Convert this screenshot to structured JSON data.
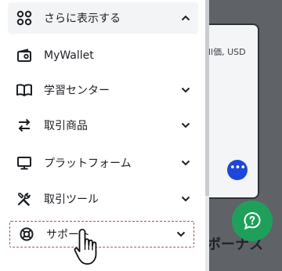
{
  "menu": {
    "items": [
      {
        "label": "さらに表示する",
        "icon": "grid-icon",
        "chevron": "up"
      },
      {
        "label": "MyWallet",
        "icon": "wallet-icon",
        "chevron": "none"
      },
      {
        "label": "学習センター",
        "icon": "book-icon",
        "chevron": "down"
      },
      {
        "label": "取引商品",
        "icon": "swap-arrows-icon",
        "chevron": "down"
      },
      {
        "label": "プラットフォーム",
        "icon": "monitor-icon",
        "chevron": "down"
      },
      {
        "label": "取引ツール",
        "icon": "tools-icon",
        "chevron": "down"
      },
      {
        "label": "サポート",
        "icon": "lifebuoy-icon",
        "chevron": "down"
      }
    ]
  },
  "background": {
    "card_text": "ll価, USD",
    "more_label": "•••",
    "heading": "ボーナス"
  },
  "colors": {
    "overlay": "#5f6368",
    "help_fab": "#1fa05a",
    "more_button": "#1e46d8",
    "hover_outline": "#a9505c"
  }
}
